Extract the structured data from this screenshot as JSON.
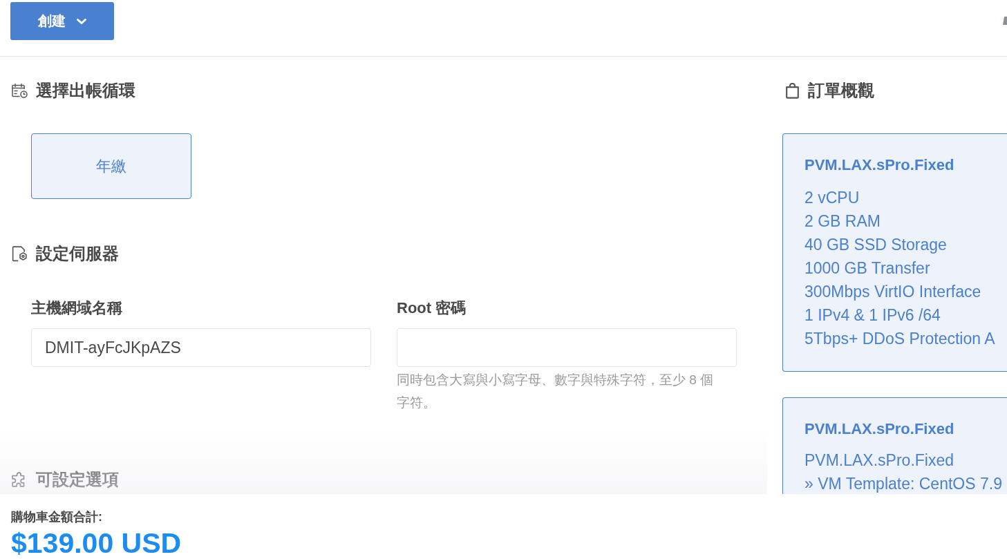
{
  "header": {
    "create_button": {
      "label": "創建"
    }
  },
  "billing_cycle": {
    "title": "選擇出帳循環",
    "options": [
      {
        "label": "年繳",
        "selected": true
      }
    ]
  },
  "server_config": {
    "title": "設定伺服器",
    "fields": [
      {
        "label": "主機網域名稱",
        "value": "DMIT-ayFcJKpAZS"
      },
      {
        "label": "Root 密碼",
        "hint": "同時包含大寫與小寫字母、數字與特殊字符，至少 8 個字符。"
      }
    ]
  },
  "configurable_options": {
    "title": "可設定選項"
  },
  "order_summary": {
    "title": "訂單概觀",
    "items": [
      {
        "name": "PVM.LAX.sPro.Fixed",
        "lines": [
          "2 vCPU",
          "2 GB RAM",
          "40 GB SSD Storage",
          "1000 GB Transfer",
          "300Mbps VirtIO Interface",
          "1 IPv4 & 1 IPv6 /64",
          "5Tbps+ DDoS Protection A"
        ]
      },
      {
        "name": "PVM.LAX.sPro.Fixed",
        "lines": [
          "PVM.LAX.sPro.Fixed",
          "» VM Template: CentOS 7.9"
        ]
      }
    ]
  },
  "cart_total": {
    "label": "購物車金額合計:",
    "amount": "$139.00 USD"
  }
}
